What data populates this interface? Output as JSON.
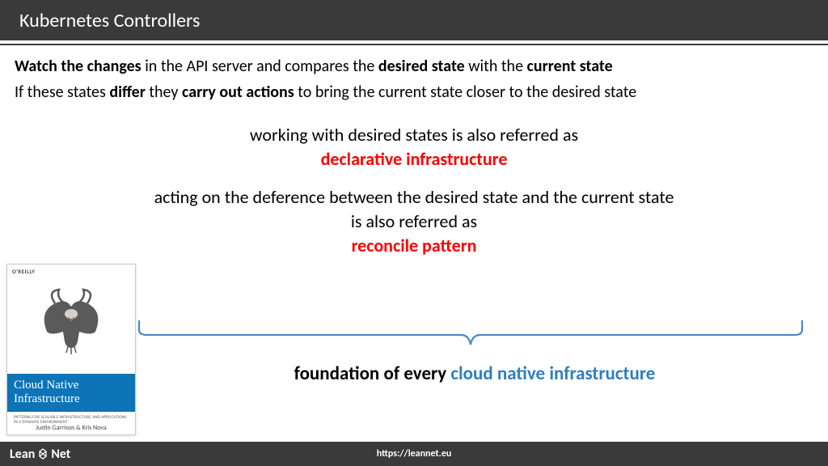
{
  "header": {
    "title": "Kubernetes Controllers"
  },
  "line1": {
    "s1": "Watch the changes",
    "s2": " in the API server and compares the ",
    "s3": "desired state",
    "s4": " with the ",
    "s5": "current state"
  },
  "line2": {
    "s1": "If these states ",
    "s2": "differ",
    "s3": " they ",
    "s4": "carry out actions",
    "s5": " to bring the current state closer to the desired state"
  },
  "center1": {
    "l1": "working with desired states is also referred as",
    "l2": "declarative infrastructure"
  },
  "center2": {
    "l1": "acting on the deference between the desired state and the current state",
    "l2": "is also referred as",
    "l3": "reconcile pattern"
  },
  "foundation": {
    "s1": "foundation of every ",
    "s2": "cloud native infrastructure"
  },
  "book": {
    "publisher": "O'REILLY",
    "title_l1": "Cloud Native",
    "title_l2": "Infrastructure",
    "subtitle": "PATTERNS FOR SCALABLE INFRASTRUCTURE AND APPLICATIONS IN A DYNAMIC ENVIRONMENT",
    "authors": "Justin Garrison & Kris Nova"
  },
  "footer": {
    "logo_l": "Lean",
    "logo_r": "Net",
    "url": "https://leannet.eu"
  },
  "colors": {
    "accent_red": "#ff0000",
    "accent_blue": "#2f7ebf",
    "brace_blue": "#4a89c8"
  }
}
